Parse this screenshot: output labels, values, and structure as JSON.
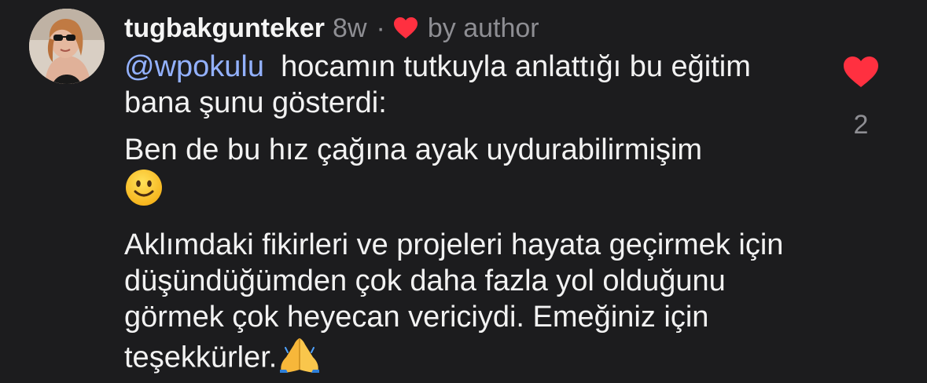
{
  "comment": {
    "username": "tugbakgunteker",
    "time": "8w",
    "separator": "·",
    "by_author": "by author",
    "mention": "@wpokulu",
    "para1_text": "  hocamın tutkuyla anlattığı bu eğitim bana şunu gösterdi:",
    "para2_text": "Ben de bu hız çağına ayak uydurabilirmişim",
    "para3_text": "Aklımdaki fikirleri ve projeleri hayata geçirmek için düşündüğümden çok daha fazla yol olduğunu görmek çok heyecan vericiydi. Emeğiniz için teşekkürler.",
    "like_count": "2"
  },
  "icons": {
    "author_heart": "heart-icon",
    "like": "heart-icon",
    "smile_emoji": "slightly-smiling-face-emoji",
    "pray_emoji": "folded-hands-emoji"
  },
  "colors": {
    "background": "#1c1c1e",
    "heart": "#ff3040",
    "mention": "#93b1ff",
    "secondary_text": "#8e8e93"
  }
}
